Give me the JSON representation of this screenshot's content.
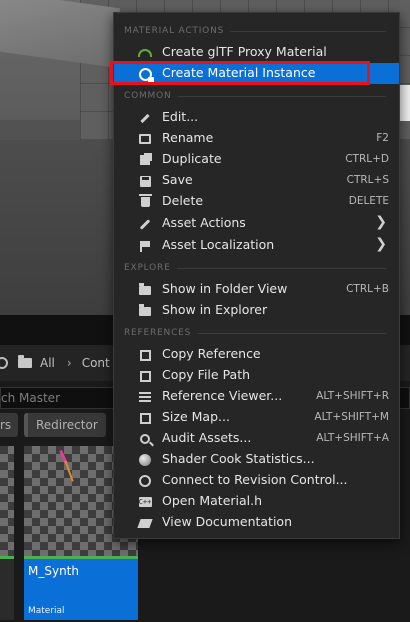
{
  "content_browser": {
    "path": [
      "All",
      "Cont"
    ],
    "search_placeholder": "ch Master",
    "filter_chips": [
      "rs",
      "Redirector"
    ],
    "asset": {
      "name": "M_Synth",
      "type": "Material"
    }
  },
  "menu": {
    "sections": {
      "material_actions": "MATERIAL ACTIONS",
      "common": "COMMON",
      "explore": "EXPLORE",
      "references": "REFERENCES"
    },
    "items": {
      "create_gltf_proxy": "Create glTF Proxy Material",
      "create_material_instance": "Create Material Instance",
      "edit": "Edit...",
      "rename": "Rename",
      "duplicate": "Duplicate",
      "save": "Save",
      "delete": "Delete",
      "asset_actions": "Asset Actions",
      "asset_localization": "Asset Localization",
      "show_in_folder_view": "Show in Folder View",
      "show_in_explorer": "Show in Explorer",
      "copy_reference": "Copy Reference",
      "copy_file_path": "Copy File Path",
      "reference_viewer": "Reference Viewer...",
      "size_map": "Size Map...",
      "audit_assets": "Audit Assets...",
      "shader_cook_statistics": "Shader Cook Statistics...",
      "connect_to_revision_control": "Connect to Revision Control...",
      "open_material_h": "Open Material.h",
      "view_documentation": "View Documentation"
    },
    "shortcuts": {
      "rename": "F2",
      "duplicate": "CTRL+D",
      "save": "CTRL+S",
      "delete": "DELETE",
      "show_in_folder_view": "CTRL+B",
      "reference_viewer": "ALT+SHIFT+R",
      "size_map": "ALT+SHIFT+M",
      "audit_assets": "ALT+SHIFT+A"
    },
    "submenu_arrow": "❯"
  },
  "colors": {
    "accent": "#0b6fd8",
    "highlight_box": "#e8121d",
    "menu_bg": "#262626"
  }
}
